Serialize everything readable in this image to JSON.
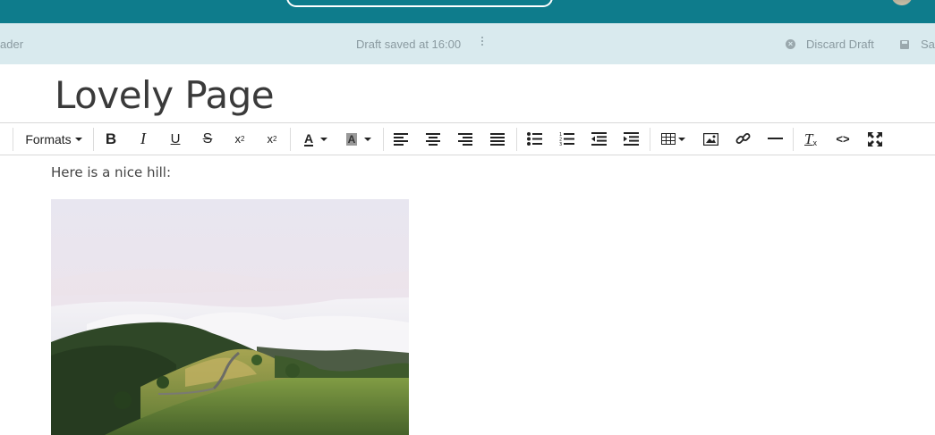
{
  "status_bar": {
    "left_text": "ader",
    "draft_status": "Draft saved at 16:00",
    "discard_label": "Discard Draft",
    "save_label": "Sa"
  },
  "page": {
    "title": "Lovely Page"
  },
  "toolbar": {
    "formats_label": "Formats",
    "items": [
      "bold-icon",
      "italic-icon",
      "underline-icon",
      "strikethrough-icon",
      "superscript-icon",
      "subscript-icon",
      "text-color-icon",
      "background-color-icon",
      "align-left-icon",
      "align-center-icon",
      "align-right-icon",
      "align-justify-icon",
      "bullet-list-icon",
      "numbered-list-icon",
      "outdent-icon",
      "indent-icon",
      "table-icon",
      "image-icon",
      "link-icon",
      "horizontal-rule-icon",
      "clear-formatting-icon",
      "source-code-icon",
      "fullscreen-icon"
    ]
  },
  "content": {
    "paragraph": "Here is a nice hill:",
    "image": "landscape-hill-photo"
  },
  "colors": {
    "topbar": "#0e7c8c",
    "statusbar": "#d9eaee"
  }
}
